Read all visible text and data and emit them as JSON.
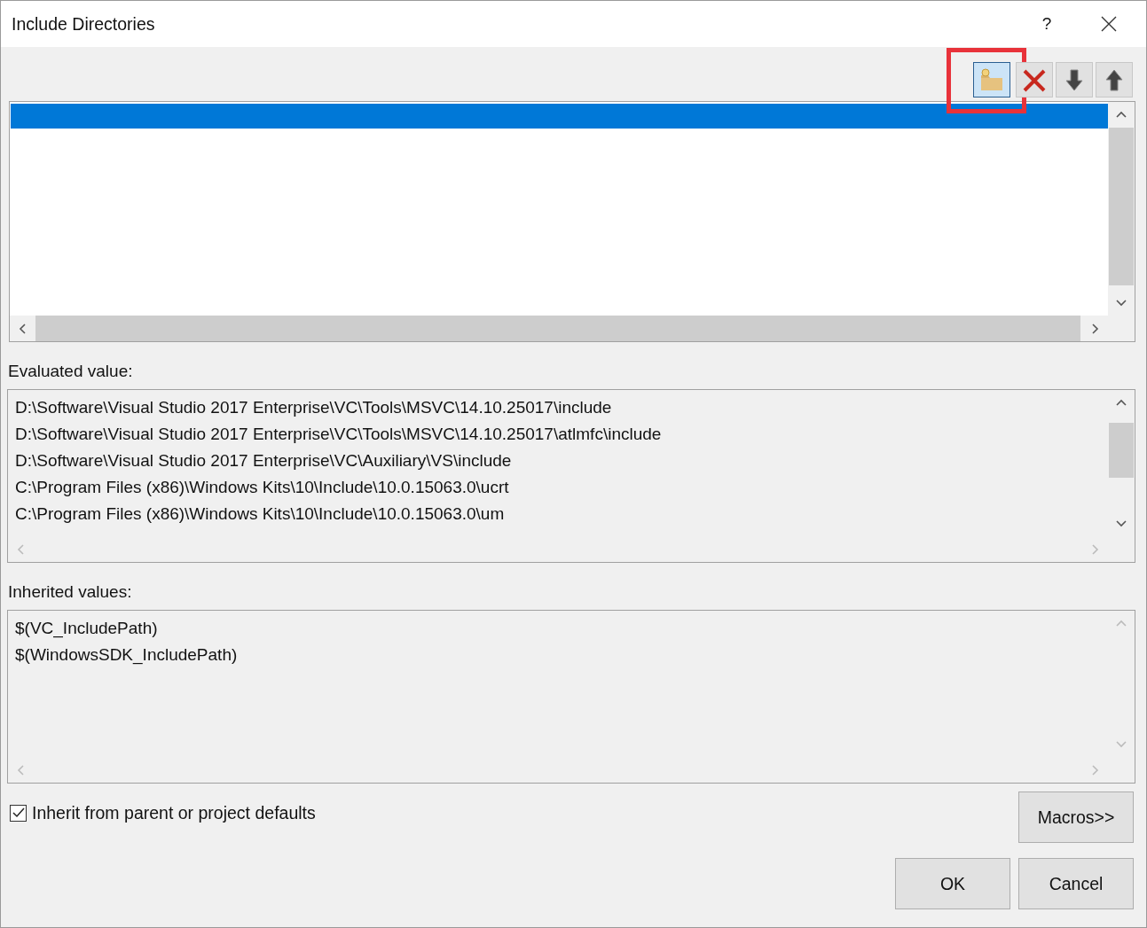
{
  "window": {
    "title": "Include Directories",
    "help": "?"
  },
  "toolbar": [
    {
      "kind": "new-folder",
      "highlighted": true
    },
    {
      "kind": "delete",
      "highlighted": false
    },
    {
      "kind": "move-down",
      "highlighted": false
    },
    {
      "kind": "move-up",
      "highlighted": false
    }
  ],
  "directory_list": {
    "rows": [
      {
        "selected": true
      }
    ]
  },
  "evaluated": {
    "label": "Evaluated value:",
    "lines": [
      "D:\\Software\\Visual Studio 2017 Enterprise\\VC\\Tools\\MSVC\\14.10.25017\\include",
      "D:\\Software\\Visual Studio 2017 Enterprise\\VC\\Tools\\MSVC\\14.10.25017\\atlmfc\\include",
      "D:\\Software\\Visual Studio 2017 Enterprise\\VC\\Auxiliary\\VS\\include",
      "C:\\Program Files (x86)\\Windows Kits\\10\\Include\\10.0.15063.0\\ucrt",
      "C:\\Program Files (x86)\\Windows Kits\\10\\Include\\10.0.15063.0\\um"
    ]
  },
  "inherited": {
    "label": "Inherited values:",
    "lines": [
      "$(VC_IncludePath)",
      "$(WindowsSDK_IncludePath)"
    ]
  },
  "inherit_checkbox": {
    "label": "Inherit from parent or project defaults",
    "checked": true
  },
  "buttons": [
    {
      "kind": "macros",
      "label": "Macros>>"
    },
    {
      "kind": "ok",
      "label": "OK"
    },
    {
      "kind": "cancel",
      "label": "Cancel"
    }
  ]
}
